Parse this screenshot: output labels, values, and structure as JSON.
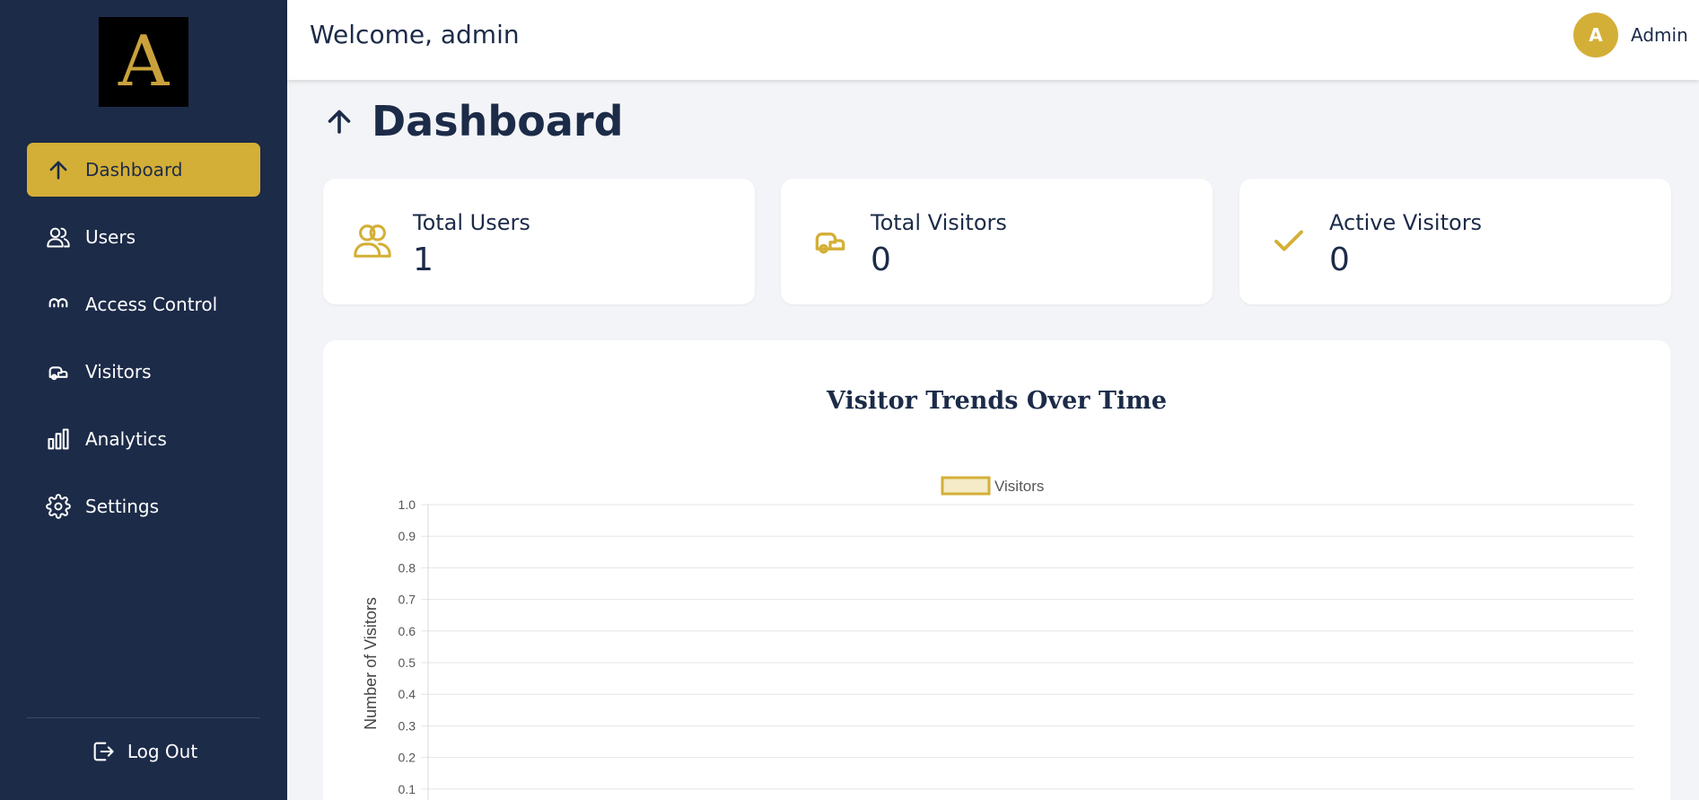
{
  "logo": {
    "letter": "A"
  },
  "sidebar": {
    "items": [
      {
        "label": "Dashboard",
        "icon": "arrow-up-icon",
        "active": true
      },
      {
        "label": "Users",
        "icon": "users-icon",
        "active": false
      },
      {
        "label": "Access Control",
        "icon": "access-icon",
        "active": false
      },
      {
        "label": "Visitors",
        "icon": "vehicle-icon",
        "active": false
      },
      {
        "label": "Analytics",
        "icon": "bar-chart-icon",
        "active": false
      },
      {
        "label": "Settings",
        "icon": "gear-icon",
        "active": false
      }
    ],
    "logout_label": "Log Out"
  },
  "header": {
    "welcome": "Welcome, admin",
    "avatar_letter": "A",
    "user_name": "Admin"
  },
  "page": {
    "title": "Dashboard"
  },
  "stats": [
    {
      "label": "Total Users",
      "value": "1",
      "icon": "users-icon"
    },
    {
      "label": "Total Visitors",
      "value": "0",
      "icon": "vehicle-icon"
    },
    {
      "label": "Active Visitors",
      "value": "0",
      "icon": "check-icon"
    }
  ],
  "colors": {
    "sidebar": "#1c2b48",
    "accent": "#d4af37",
    "background": "#f3f4f7"
  },
  "chart_data": {
    "type": "line",
    "title": "Visitor Trends Over Time",
    "ylabel": "Number of Visitors",
    "xlabel": "",
    "series": [
      {
        "name": "Visitors",
        "values": []
      }
    ],
    "yticks": [
      "1.0",
      "0.9",
      "0.8",
      "0.7",
      "0.6",
      "0.5",
      "0.4",
      "0.3",
      "0.2",
      "0.1"
    ],
    "ylim": [
      0,
      1
    ],
    "grid": true,
    "legend": "top-center"
  }
}
